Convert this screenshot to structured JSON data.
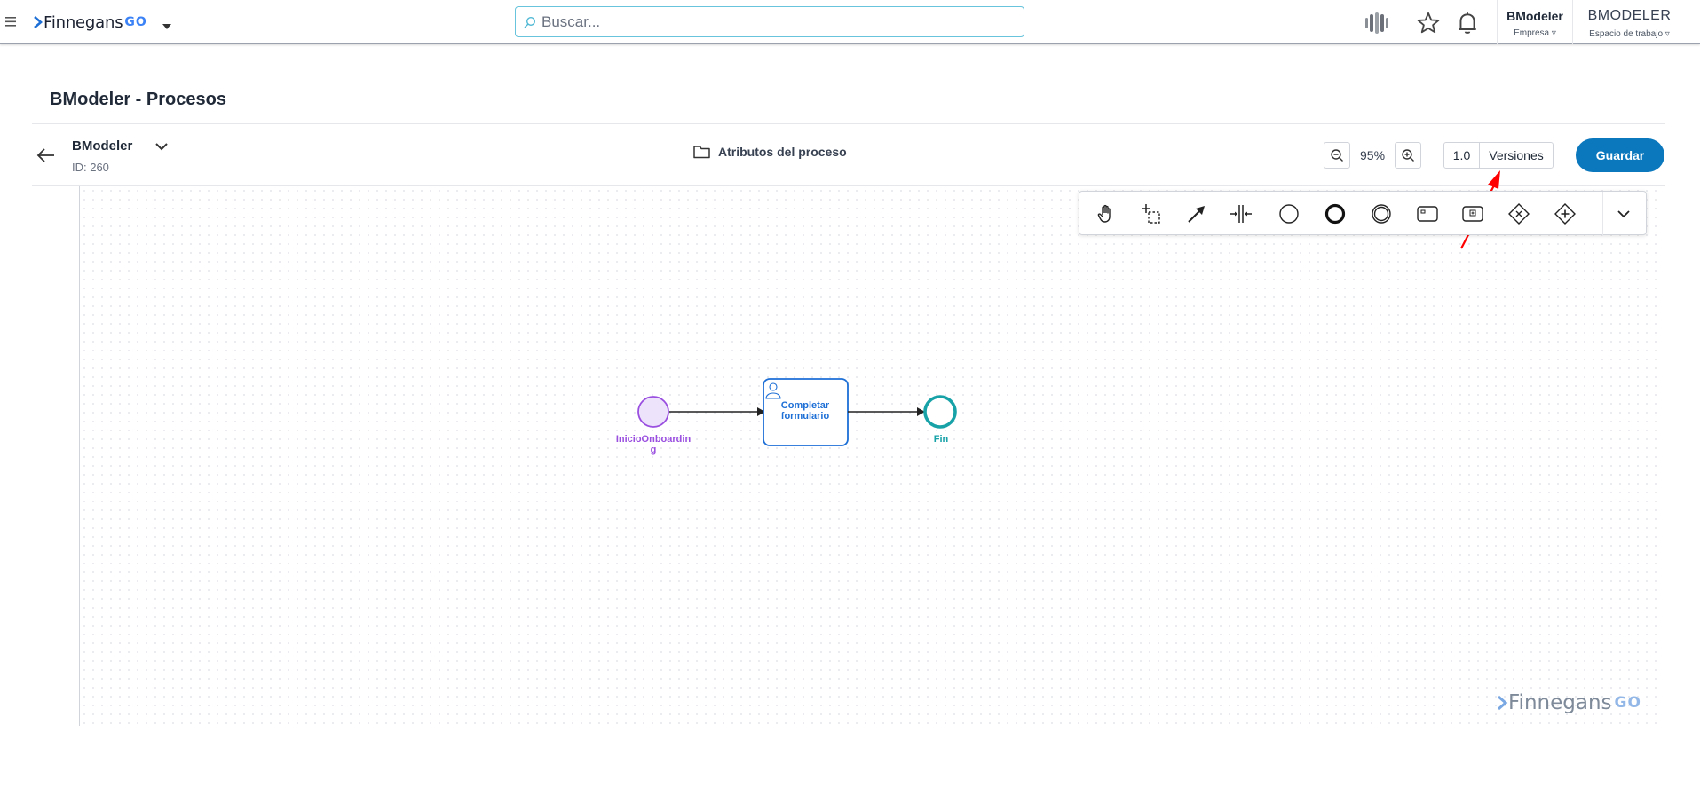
{
  "topbar": {
    "logo_text": "Finnegans",
    "logo_go": "GO",
    "search_placeholder": "Buscar...",
    "company_name": "BModeler",
    "company_sub": "Empresa ▿",
    "workspace_name": "BMODELER",
    "workspace_sub": "Espacio de trabajo ▿"
  },
  "page": {
    "title": "BModeler - Procesos"
  },
  "process": {
    "name": "BModeler",
    "id_label": "ID: 260",
    "attributes_label": "Atributos del proceso",
    "zoom": "95%",
    "version": "1.0",
    "versions_label": "Versiones",
    "save_label": "Guardar"
  },
  "diagram": {
    "start_label": "InicioOnboarding",
    "task_label": "Completar formulario",
    "end_label": "Fin"
  },
  "watermark": {
    "text": "Finnegans",
    "go": "GO"
  },
  "icons": [
    "menu-icon",
    "search-icon",
    "sentiment-icon",
    "star-icon",
    "bell-icon",
    "back-arrow-icon",
    "folder-icon",
    "zoom-out-icon",
    "zoom-in-icon",
    "hand-tool-icon",
    "lasso-tool-icon",
    "connect-tool-icon",
    "space-tool-icon",
    "start-event-icon",
    "end-event-icon",
    "intermediate-event-icon",
    "task-icon",
    "subprocess-icon",
    "exclusive-gateway-icon",
    "parallel-gateway-icon",
    "chevron-down-icon"
  ],
  "colors": {
    "accent": "#0b78bd",
    "start_event": "#9a4fe0",
    "task": "#1d6fd6",
    "end_event": "#17a2a8",
    "annotation_arrow": "#ff0000"
  }
}
